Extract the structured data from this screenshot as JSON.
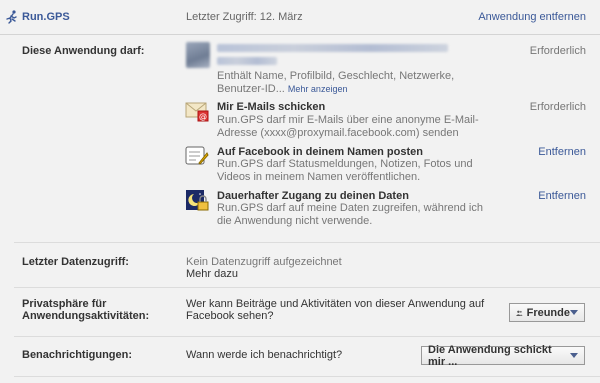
{
  "header": {
    "app_name": "Run.GPS",
    "last_access": "Letzter Zugriff: 12. März",
    "remove_label": "Anwendung entfernen"
  },
  "permissions": {
    "label": "Diese Anwendung darf:",
    "basic": {
      "desc": "Enthält Name, Profilbild, Geschlecht, Netzwerke, Benutzer-ID...",
      "more": "Mehr anzeigen",
      "status": "Erforderlich"
    },
    "items": [
      {
        "icon": "email-icon",
        "title": "Mir E-Mails schicken",
        "desc": "Run.GPS darf mir E-Mails über eine anonyme E-Mail-Adresse (xxxx@proxymail.facebook.com) senden",
        "status": "Erforderlich"
      },
      {
        "icon": "post-wall-icon",
        "title": "Auf Facebook in deinem Namen posten",
        "desc": "Run.GPS darf Statusmeldungen, Notizen, Fotos und Videos in meinem Namen veröffentlichen.",
        "action": "Entfernen"
      },
      {
        "icon": "offline-access-icon",
        "title": "Dauerhafter Zugang zu deinen Daten",
        "desc": "Run.GPS darf auf meine Daten zugreifen, während ich die Anwendung nicht verwende.",
        "action": "Entfernen"
      }
    ]
  },
  "data_access": {
    "label": "Letzter Datenzugriff:",
    "text": "Kein Datenzugriff aufgezeichnet",
    "more": "Mehr dazu"
  },
  "privacy": {
    "label_line1": "Privatsphäre für",
    "label_line2": "Anwendungsaktivitäten:",
    "question_line1": "Wer kann Beiträge und Aktivitäten von dieser Anwendung auf",
    "question_line2": "Facebook sehen?",
    "selected": "Freunde"
  },
  "notifications": {
    "label": "Benachrichtigungen:",
    "question": "Wann werde ich benachrichtigt?",
    "selected": "Die Anwendung schickt mir ..."
  }
}
